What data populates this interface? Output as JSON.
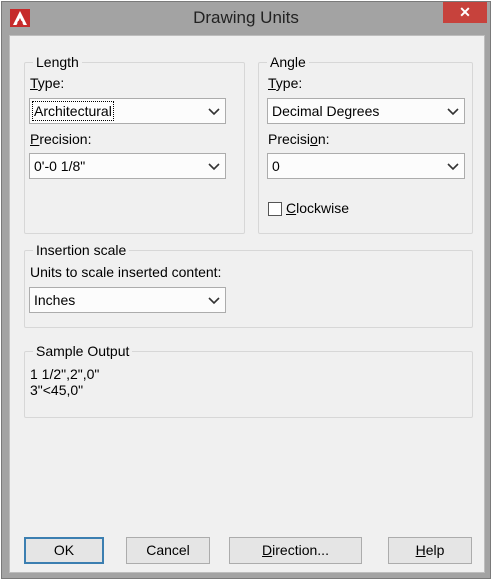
{
  "window": {
    "title": "Drawing Units",
    "close_label": "✕",
    "icon": "autocad-logo-icon"
  },
  "length": {
    "legend": "Length",
    "type_label": "Type:",
    "type_value": "Architectural",
    "precision_label": "Precision:",
    "precision_value": "0'-0 1/8\""
  },
  "angle": {
    "legend": "Angle",
    "type_label": "Type:",
    "type_value": "Decimal Degrees",
    "precision_label": "Precision:",
    "precision_value": "0",
    "clockwise_label": "Clockwise",
    "clockwise_checked": false
  },
  "insertion": {
    "legend": "Insertion scale",
    "units_label": "Units to scale inserted content:",
    "units_value": "Inches"
  },
  "sample": {
    "legend": "Sample Output",
    "line1": "1 1/2\",2\",0\"",
    "line2": "3\"<45,0\""
  },
  "buttons": {
    "ok": "OK",
    "cancel": "Cancel",
    "direction": "Direction...",
    "help": "Help"
  },
  "colors": {
    "close_button": "#c7423c",
    "frame": "#a3a3a3",
    "client": "#f0f0f0",
    "default_button_border": "#3c7fb1"
  }
}
